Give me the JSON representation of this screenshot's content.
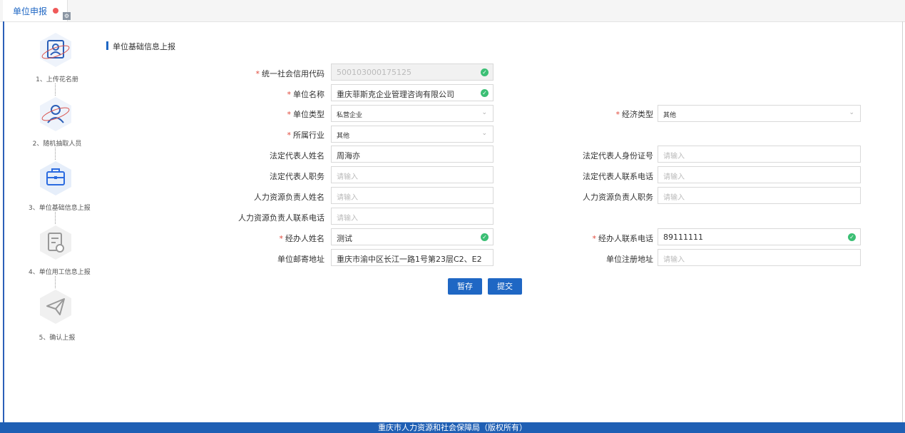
{
  "tab": {
    "label": "单位申报",
    "close_icon": "close-icon",
    "settings_icon": "gear-icon"
  },
  "steps": [
    {
      "label": "1、上传花名册",
      "icon": "roster-upload-icon"
    },
    {
      "label": "2、随机抽取人员",
      "icon": "random-person-icon"
    },
    {
      "label": "3、单位基础信息上报",
      "icon": "briefcase-icon"
    },
    {
      "label": "4、单位用工信息上报",
      "icon": "document-icon"
    },
    {
      "label": "5、确认上报",
      "icon": "paper-plane-icon"
    }
  ],
  "section": {
    "title": "单位基础信息上报"
  },
  "fields": {
    "credit_code": {
      "label": "统一社会信用代码",
      "value": "500103000175125"
    },
    "unit_name": {
      "label": "单位名称",
      "value": "重庆菲斯克企业管理咨询有限公司"
    },
    "unit_type": {
      "label": "单位类型",
      "value": "私营企业"
    },
    "economy_type": {
      "label": "经济类型",
      "value": "其他"
    },
    "industry": {
      "label": "所属行业",
      "value": "其他"
    },
    "legal_rep_name": {
      "label": "法定代表人姓名",
      "value": "周海亦"
    },
    "legal_rep_id": {
      "label": "法定代表人身份证号",
      "placeholder": "请输入"
    },
    "legal_rep_post": {
      "label": "法定代表人职务",
      "placeholder": "请输入"
    },
    "legal_rep_phone": {
      "label": "法定代表人联系电话",
      "placeholder": "请输入"
    },
    "hr_name": {
      "label": "人力资源负责人姓名",
      "placeholder": "请输入"
    },
    "hr_post": {
      "label": "人力资源负责人职务",
      "placeholder": "请输入"
    },
    "hr_phone": {
      "label": "人力资源负责人联系电话",
      "placeholder": "请输入"
    },
    "handler_name": {
      "label": "经办人姓名",
      "value": "测试"
    },
    "handler_phone": {
      "label": "经办人联系电话",
      "value": "89111111"
    },
    "mail_address": {
      "label": "单位邮寄地址",
      "value": "重庆市渝中区长江一路1号第23层C2、E2"
    },
    "reg_address": {
      "label": "单位注册地址",
      "placeholder": "请输入"
    }
  },
  "buttons": {
    "save_draft": "暂存",
    "submit": "提交"
  },
  "footer": {
    "text": "重庆市人力资源和社会保障局（版权所有）"
  },
  "colors": {
    "accent": "#1f67c4",
    "success": "#3bbf74",
    "required": "#e0483a"
  }
}
